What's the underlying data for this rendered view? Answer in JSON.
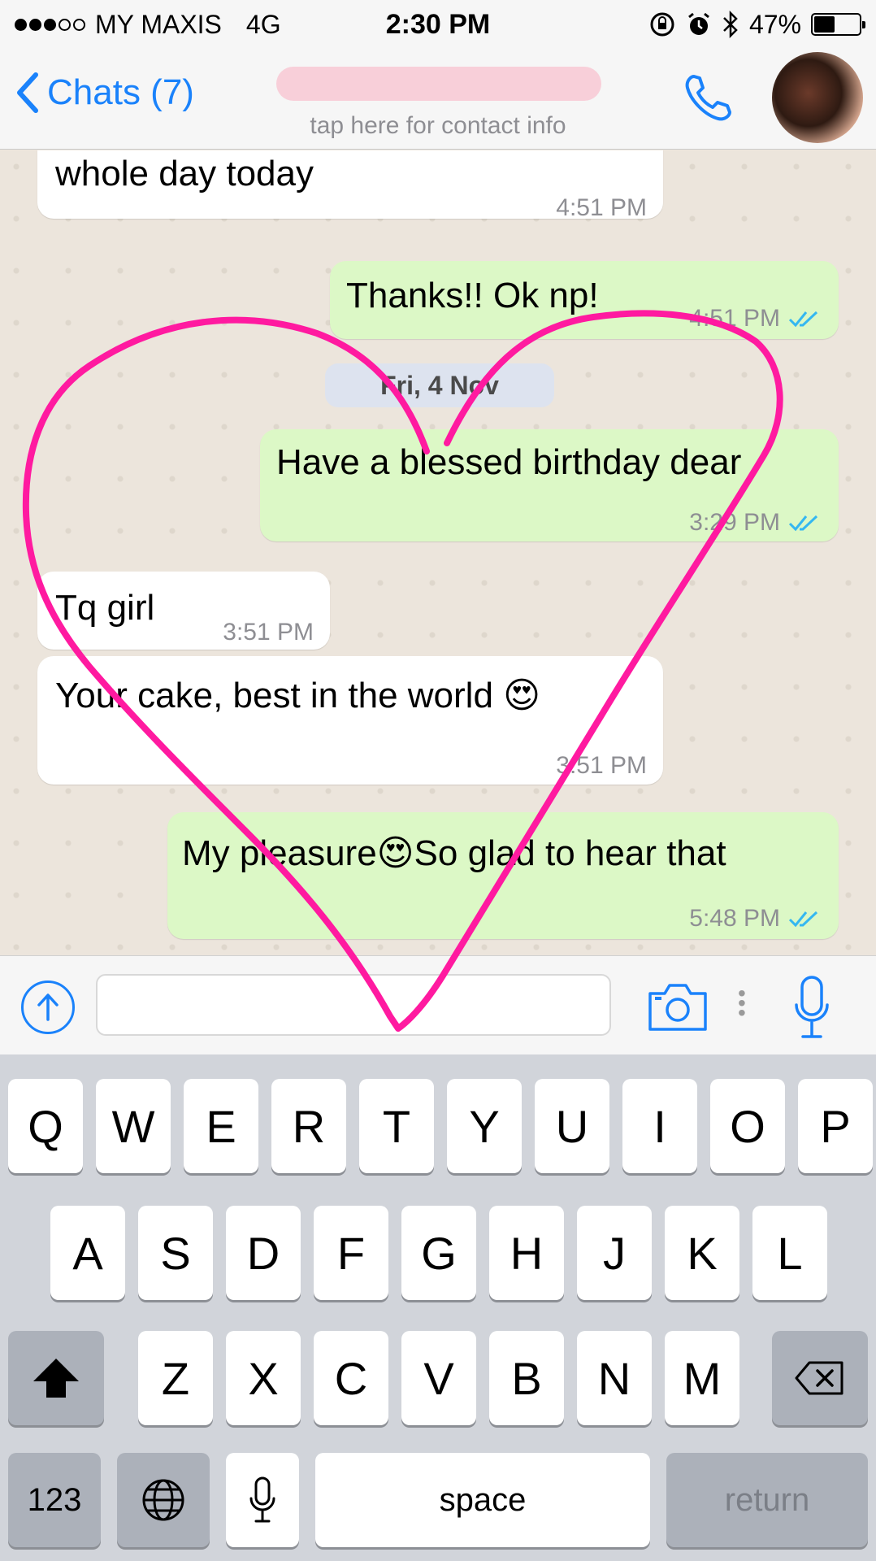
{
  "status_bar": {
    "carrier": "MY MAXIS",
    "network": "4G",
    "time": "2:30 PM",
    "battery": "47%",
    "battery_level": 0.47
  },
  "header": {
    "back_label": "Chats (7)",
    "subtitle": "tap here for contact info"
  },
  "messages": [
    {
      "dir": "in",
      "text": "whole day today",
      "time": "4:51 PM"
    },
    {
      "dir": "out",
      "text": "Thanks!! Ok np!",
      "time": "4:51 PM"
    },
    {
      "dir": "out",
      "text": "Have a blessed birthday dear",
      "time": "3:29 PM"
    },
    {
      "dir": "in",
      "text": "Tq girl",
      "time": "3:51 PM"
    },
    {
      "dir": "in",
      "text": "Your cake, best in the world 😍",
      "time": "3:51 PM"
    },
    {
      "dir": "out",
      "text": "My pleasure😍So glad to hear that",
      "time": "5:48 PM"
    }
  ],
  "date_divider": "Fri, 4 Nov",
  "input": {
    "value": "",
    "placeholder": ""
  },
  "keyboard": {
    "row1": [
      "Q",
      "W",
      "E",
      "R",
      "T",
      "Y",
      "U",
      "I",
      "O",
      "P"
    ],
    "row2": [
      "A",
      "S",
      "D",
      "F",
      "G",
      "H",
      "J",
      "K",
      "L"
    ],
    "row3": [
      "Z",
      "X",
      "C",
      "V",
      "B",
      "N",
      "M"
    ],
    "numbers_label": "123",
    "space_label": "space",
    "return_label": "return"
  },
  "colors": {
    "accent": "#1a82fb",
    "outgoing_bubble": "#dcf8c6",
    "incoming_bubble": "#ffffff",
    "doodle": "#ff1aa0"
  }
}
